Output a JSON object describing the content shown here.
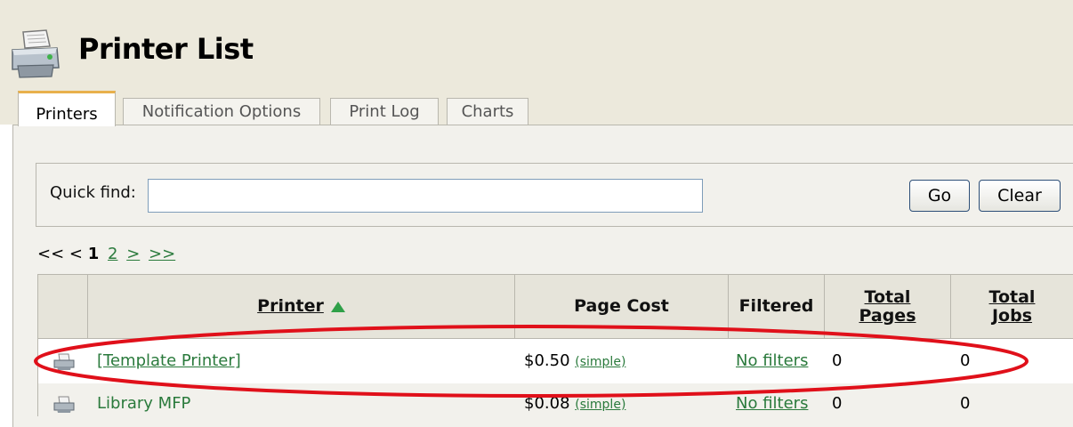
{
  "header": {
    "title": "Printer List",
    "icon": "printer-icon"
  },
  "tabs": [
    {
      "label": "Printers",
      "active": true
    },
    {
      "label": "Notification Options",
      "active": false
    },
    {
      "label": "Print Log",
      "active": false
    },
    {
      "label": "Charts",
      "active": false
    }
  ],
  "quick_find": {
    "label": "Quick find:",
    "value": "",
    "go_label": "Go",
    "clear_label": "Clear"
  },
  "pager": {
    "first": "<<",
    "prev": "<",
    "current": "1",
    "page2": "2",
    "next": ">",
    "last": ">>"
  },
  "table": {
    "columns": {
      "printer": "Printer",
      "page_cost": "Page Cost",
      "filtered": "Filtered",
      "total_pages_line1": "Total",
      "total_pages_line2": "Pages",
      "total_jobs_line1": "Total",
      "total_jobs_line2": "Jobs"
    },
    "rows": [
      {
        "printer": "[Template Printer]",
        "cost": "$0.50",
        "cost_mode": "(simple)",
        "filtered": "No filters",
        "total_pages": "0",
        "total_jobs": "0"
      },
      {
        "printer": "Library MFP",
        "cost": "$0.08",
        "cost_mode": "(simple)",
        "filtered": "No filters",
        "total_pages": "0",
        "total_jobs": "0"
      }
    ]
  },
  "colors": {
    "link_green": "#2a7a3c",
    "highlight_red": "#e0101a",
    "band": "#ece9dc",
    "active_tab_accent": "#e8b04c"
  }
}
